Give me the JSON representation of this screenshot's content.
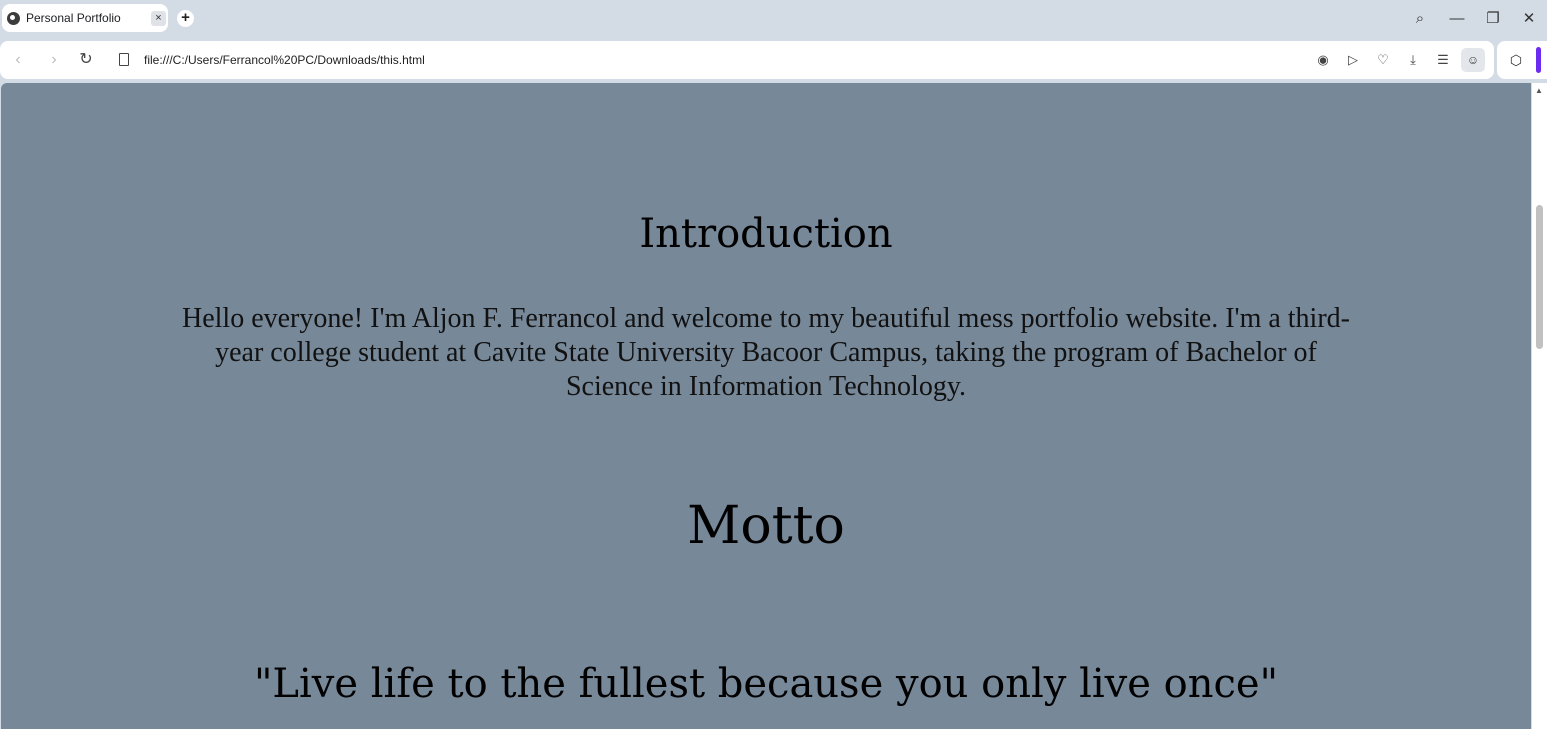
{
  "browser": {
    "tab_title": "Personal Portfolio",
    "tab_close": "×",
    "new_tab": "+",
    "url": "file:///C:/Users/Ferrancol%20PC/Downloads/this.html",
    "window_controls": {
      "search": "⌕",
      "minimize": "—",
      "restore": "❐",
      "close": "✕"
    },
    "toolbar_icons": [
      "camera-icon",
      "send-icon",
      "heart-icon",
      "download-icon",
      "menu-icon",
      "profile-icon"
    ]
  },
  "page": {
    "background": "#778899",
    "intro_heading": "Introduction",
    "intro_text": "Hello everyone! I'm Aljon F. Ferrancol and welcome to my beautiful mess portfolio website. I'm a third-year college student at Cavite State University Bacoor Campus, taking the program of Bachelor of Science in Information Technology.",
    "motto_heading": "Motto",
    "motto_text": "\"Live life to the fullest because you only live once\""
  }
}
